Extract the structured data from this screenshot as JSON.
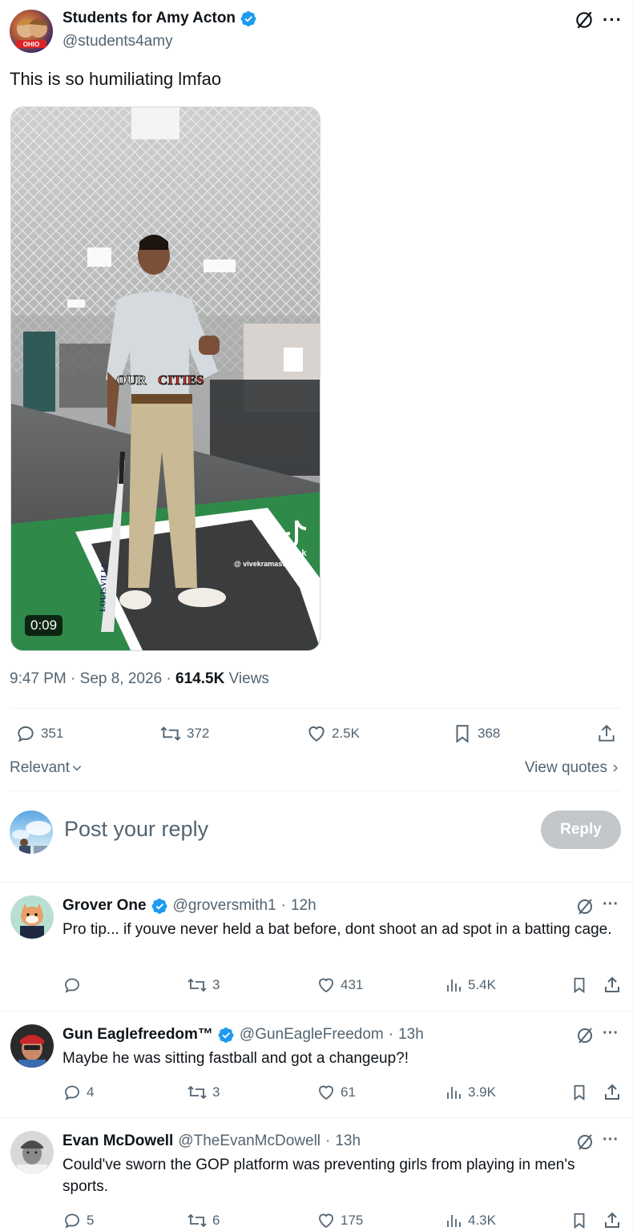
{
  "post": {
    "author_name": "Students for Amy Acton",
    "author_handle": "@students4amy",
    "text": "This is so humiliating lmfao",
    "video": {
      "duration": "0:09",
      "overlay_text_a": "OUR",
      "overlay_text_b": "CITIES",
      "tiktok_label": "TikTok",
      "tiktok_handle": "@ vivekramaswamy",
      "bat_text": "LOUISVILLE"
    },
    "time": "9:47 PM",
    "date": "Sep 8, 2026",
    "views_count": "614.5K",
    "views_label": "Views",
    "stats": {
      "replies": "351",
      "reposts": "372",
      "likes": "2.5K",
      "bookmarks": "368"
    },
    "sort_label": "Relevant",
    "view_quotes_label": "View quotes"
  },
  "composer": {
    "placeholder": "Post your reply",
    "reply_button": "Reply"
  },
  "replies": [
    {
      "name": "Grover One",
      "verified": true,
      "handle": "@groversmith1",
      "time": "12h",
      "text": "Pro tip... if youve never held a bat before, dont shoot an ad spot in a batting cage.",
      "replies": "",
      "reposts": "3",
      "likes": "431",
      "views": "5.4K"
    },
    {
      "name": "Gun Eaglefreedom™",
      "verified": true,
      "handle": "@GunEagleFreedom",
      "time": "13h",
      "text": "Maybe he was sitting fastball and got a changeup?!",
      "replies": "4",
      "reposts": "3",
      "likes": "61",
      "views": "3.9K"
    },
    {
      "name": "Evan McDowell",
      "verified": false,
      "handle": "@TheEvanMcDowell",
      "time": "13h",
      "text": "Could've sworn the GOP platform was preventing girls from playing in men's sports.",
      "replies": "5",
      "reposts": "6",
      "likes": "175",
      "views": "4.3K"
    }
  ],
  "colors": {
    "verified_blue": "#1d9bf0",
    "muted_gray": "#536471",
    "reply_button_bg": "#c3c7ca",
    "divider": "#eff3f4"
  }
}
